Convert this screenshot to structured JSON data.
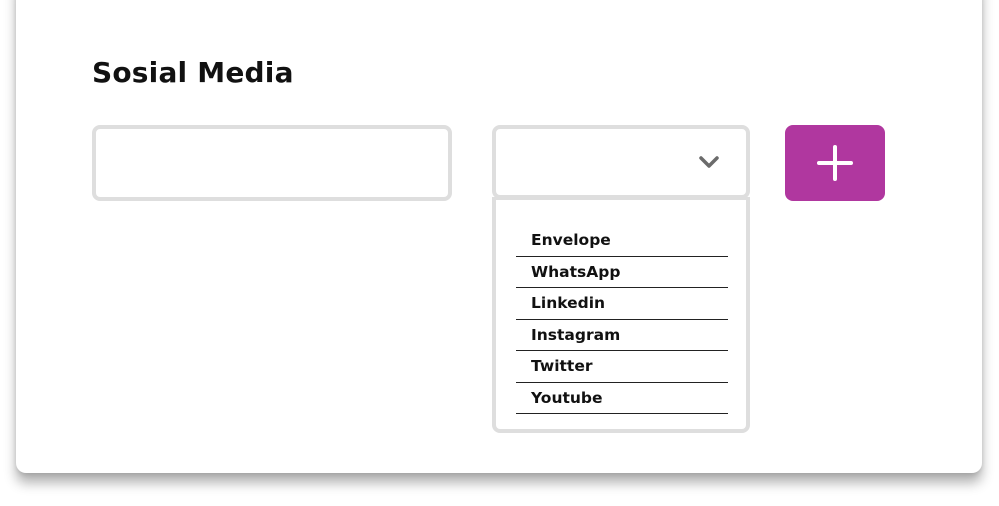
{
  "form": {
    "title": "Sosial Media",
    "link_input": {
      "value": "",
      "placeholder": ""
    },
    "platform_select": {
      "selected": "",
      "options": [
        "Envelope",
        "WhatsApp",
        "Linkedin",
        "Instagram",
        "Twitter",
        "Youtube"
      ]
    },
    "add_button": {
      "icon": "plus-icon"
    }
  },
  "colors": {
    "accent": "#b0379f",
    "border": "#dedede",
    "chevron": "#6b6b6b"
  }
}
